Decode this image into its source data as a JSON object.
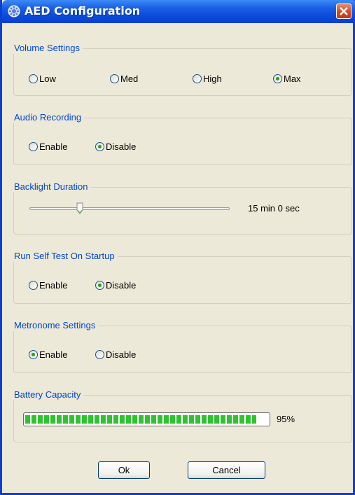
{
  "window": {
    "title": "AED Configuration"
  },
  "volume": {
    "legend": "Volume Settings",
    "options": [
      "Low",
      "Med",
      "High",
      "Max"
    ],
    "selected": "Max"
  },
  "audio": {
    "legend": "Audio Recording",
    "options": [
      "Enable",
      "Disable"
    ],
    "selected": "Disable"
  },
  "backlight": {
    "legend": "Backlight Duration",
    "value_text": "15 min 0 sec",
    "slider_fraction": 0.25
  },
  "selftest": {
    "legend": "Run Self Test On Startup",
    "options": [
      "Enable",
      "Disable"
    ],
    "selected": "Disable"
  },
  "metronome": {
    "legend": "Metronome Settings",
    "options": [
      "Enable",
      "Disable"
    ],
    "selected": "Enable"
  },
  "battery": {
    "legend": "Battery Capacity",
    "percent_text": "95%",
    "level_percent": 95
  },
  "buttons": {
    "ok": "Ok",
    "cancel": "Cancel"
  },
  "colors": {
    "title_bar": "#0a4bd8",
    "legend_text": "#0046d5",
    "progress_fill": "#2fc32f",
    "close_button": "#d24a25"
  }
}
